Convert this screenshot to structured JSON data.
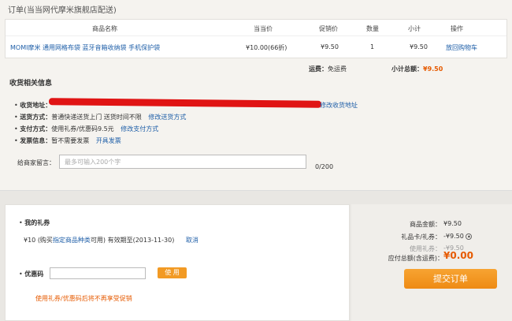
{
  "order": {
    "title": "订单(当当网代摩米旗舰店配送)",
    "columns": [
      "商品名称",
      "当当价",
      "促销价",
      "数量",
      "小计",
      "操作"
    ],
    "item": {
      "name": "MOMI摩米 通用网格布袋 蓝牙音箱收纳袋 手机保护袋",
      "dangdang_price": "¥10.00(66折)",
      "promo_price": "¥9.50",
      "quantity": "1",
      "subtotal": "¥9.50",
      "action": "放回购物车"
    },
    "shipping_label": "运费：",
    "shipping_value": "免运费",
    "subtotal_label": "小计总额：",
    "subtotal_value": "¥9.50"
  },
  "receiving": {
    "section_title": "收货相关信息",
    "address_label": "收货地址：",
    "address_edit": "修改收货地址",
    "delivery_label": "送货方式：",
    "delivery_value": "普通快递送货上门   送货时间不限",
    "delivery_edit": "修改送货方式",
    "payment_label": "支付方式：",
    "payment_value": "使用礼券/优惠码9.5元",
    "payment_edit": "修改支付方式",
    "invoice_label": "发票信息：",
    "invoice_value": "暂不需要发票",
    "invoice_edit": "开具发票",
    "message_label": "给商家留言：",
    "message_placeholder": "最多可输入200个字",
    "message_count": "0/200"
  },
  "gift": {
    "title": "我的礼券",
    "coupon_prefix": "¥10 (购买",
    "coupon_link": "指定商品种类",
    "coupon_suffix": "可用) 有效期至(2013-11-30)",
    "cancel": "取消",
    "promo_label": "优惠码",
    "use_button": "使 用",
    "notice": "使用礼券/优惠码后将不再享受促销"
  },
  "summary": {
    "goods_label": "商品金额：",
    "goods_value": "¥9.50",
    "giftcard_label": "礼品卡/礼券：",
    "giftcard_value": "-¥9.50",
    "used_label": "使用礼券：",
    "used_value": "-¥9.50",
    "total_label": "应付总额(含运费)：",
    "total_value": "¥0.00",
    "submit": "提交订单"
  },
  "colors": {
    "accent": "#f29a24",
    "link": "#1f5fa8",
    "price": "#e65a00"
  }
}
